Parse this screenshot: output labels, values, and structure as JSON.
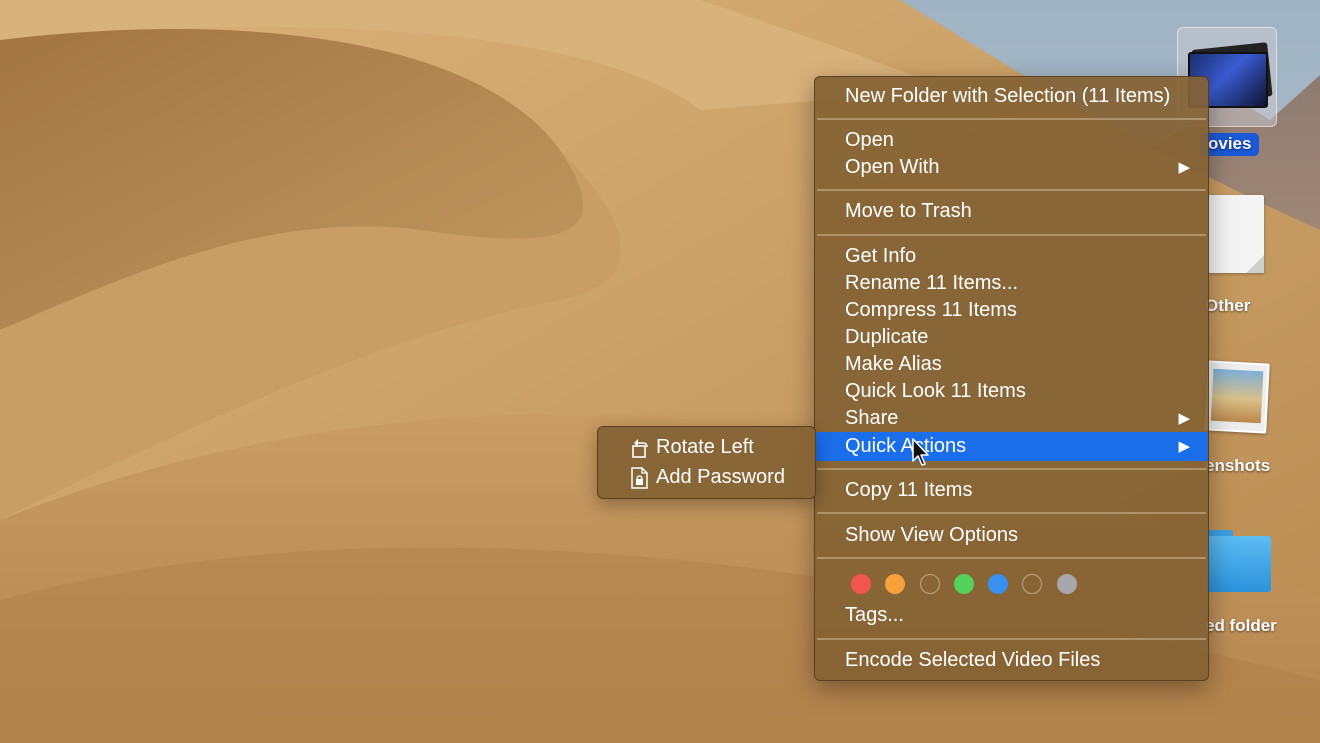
{
  "desktop": {
    "icons": [
      {
        "label": "ovies"
      },
      {
        "label": "Other"
      },
      {
        "label": "enshots"
      },
      {
        "label": "ed folder"
      }
    ]
  },
  "context_menu": {
    "sections": [
      {
        "items": [
          {
            "label": "New Folder with Selection (11 Items)"
          }
        ]
      },
      {
        "items": [
          {
            "label": "Open"
          },
          {
            "label": "Open With",
            "submenu_arrow": "▶"
          }
        ]
      },
      {
        "items": [
          {
            "label": "Move to Trash"
          }
        ]
      },
      {
        "items": [
          {
            "label": "Get Info"
          },
          {
            "label": "Rename 11 Items..."
          },
          {
            "label": "Compress 11 Items"
          },
          {
            "label": "Duplicate"
          },
          {
            "label": "Make Alias"
          },
          {
            "label": "Quick Look 11 Items"
          },
          {
            "label": "Share",
            "submenu_arrow": "▶"
          },
          {
            "label": "Quick Actions",
            "submenu_arrow": "▶",
            "highlighted": true
          }
        ]
      },
      {
        "items": [
          {
            "label": "Copy 11 Items"
          }
        ]
      },
      {
        "items": [
          {
            "label": "Show View Options"
          }
        ]
      },
      {
        "tags": {
          "colors": [
            "#f25450",
            "#f7a13a",
            "",
            "#52d15b",
            "#3a8ff0",
            "",
            "#a7a7ab"
          ],
          "label": "Tags..."
        }
      },
      {
        "items": [
          {
            "label": "Encode Selected Video Files"
          }
        ]
      }
    ],
    "highlight_color": "#1a6eea"
  },
  "quick_actions_submenu": {
    "items": [
      {
        "label": "Rotate Left",
        "icon": "rotate-left-icon"
      },
      {
        "label": "Add Password",
        "icon": "lock-document-icon"
      }
    ]
  }
}
